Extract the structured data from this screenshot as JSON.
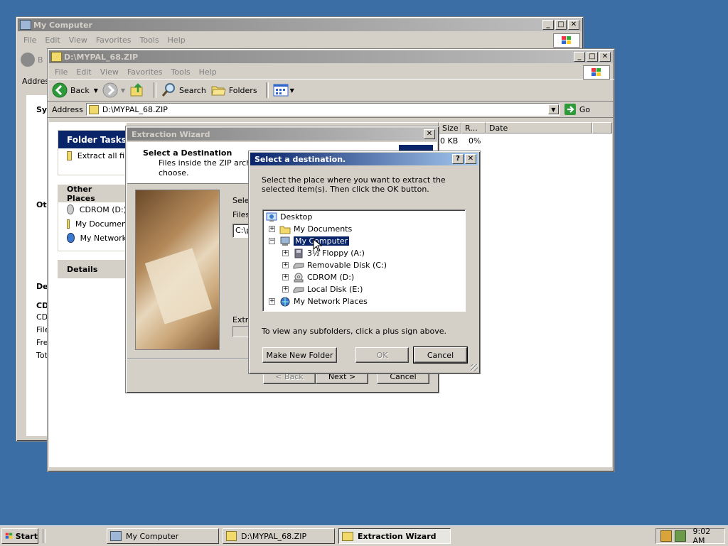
{
  "back_window": {
    "title": "My Computer",
    "menu": [
      "File",
      "Edit",
      "View",
      "Favorites",
      "Tools",
      "Help"
    ],
    "address_label": "Addres",
    "back_fragment": "B",
    "sections": [
      "Sys",
      "Oth",
      "De"
    ],
    "details_lines": [
      "CD",
      "CD",
      "File",
      "Fre",
      "Tot"
    ]
  },
  "zip_window": {
    "title": "D:\\MYPAL_68.ZIP",
    "menu": [
      "File",
      "Edit",
      "View",
      "Favorites",
      "Tools",
      "Help"
    ],
    "toolbar": {
      "back": "Back",
      "search": "Search",
      "folders": "Folders"
    },
    "address_label": "Address",
    "address_value": "D:\\MYPAL_68.ZIP",
    "go_label": "Go",
    "folder_tasks": {
      "heading": "Folder Tasks",
      "item": "Extract all fil"
    },
    "other_places": {
      "heading": "Other Places",
      "items": [
        "CDROM (D:)",
        "My Documen",
        "My Network"
      ]
    },
    "details_heading": "Details",
    "columns": [
      "Size",
      "R...",
      "Date"
    ],
    "file_row": {
      "size": "0 KB",
      "ratio": "0%"
    }
  },
  "wizard": {
    "title": "Extraction Wizard",
    "heading": "Select a Destination",
    "desc_line1": "Files inside the ZIP archive",
    "desc_line2": "choose.",
    "select_label": "Sele",
    "files_label": "Files",
    "path_value": "C:\\p",
    "extract_label": "Extra",
    "buttons": {
      "back": "< Back",
      "next": "Next >",
      "cancel": "Cancel"
    }
  },
  "dialog": {
    "title": "Select a destination.",
    "help_btn": "?",
    "close_btn": "✕",
    "instruction": "Select the place where you want to extract the selected item(s).  Then click the OK button.",
    "tree": [
      {
        "label": "Desktop",
        "expander": "",
        "icon": "desktop-icon"
      },
      {
        "label": "My Documents",
        "expander": "+",
        "icon": "folder-icon"
      },
      {
        "label": "My Computer",
        "expander": "−",
        "icon": "computer-icon",
        "selected": true
      },
      {
        "label": "3½ Floppy (A:)",
        "expander": "+",
        "icon": "floppy-icon"
      },
      {
        "label": "Removable Disk (C:)",
        "expander": "+",
        "icon": "drive-icon"
      },
      {
        "label": "CDROM (D:)",
        "expander": "+",
        "icon": "cdrom-icon"
      },
      {
        "label": "Local Disk (E:)",
        "expander": "+",
        "icon": "drive-icon"
      },
      {
        "label": "My Network Places",
        "expander": "+",
        "icon": "network-icon"
      }
    ],
    "hint": "To view any subfolders, click a plus sign above.",
    "buttons": {
      "new_folder": "Make New Folder",
      "ok": "OK",
      "cancel": "Cancel"
    }
  },
  "taskbar": {
    "start": "Start",
    "tasks": [
      "My Computer",
      "D:\\MYPAL_68.ZIP",
      "Extraction Wizard"
    ],
    "clock": "9:02 AM"
  },
  "colors": {
    "desktop": "#3a6ea5",
    "active_title_start": "#0a246a",
    "active_title_end": "#a6caf0",
    "face": "#d4d0c8",
    "selection": "#0a246a"
  }
}
